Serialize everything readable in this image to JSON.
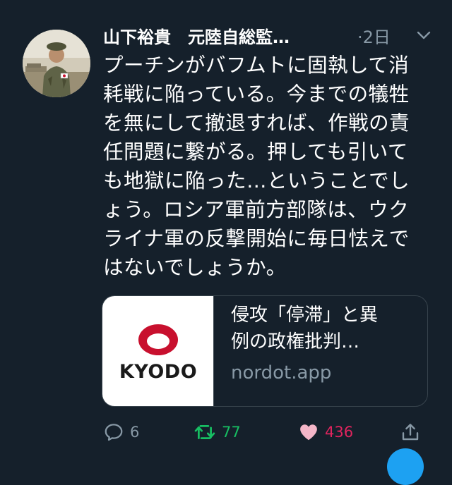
{
  "tweet": {
    "author_name": "山下裕貴　元陸自総監…",
    "timestamp": "·2日",
    "text_lines": [
      "プーチンがバフムトに固執して消",
      "耗戦に陥っている。今までの犠牲",
      "を無にして撤退すれば、作戦の責",
      "任問題に繋がる。押しても引いて",
      "も地獄に陥った…ということでし",
      "ょう。ロシア軍前方部隊は、ウク",
      "ライナ軍の反撃開始に毎日怯えで",
      "はないでしょうか。"
    ],
    "icons": {
      "more": "chevron-down-icon",
      "reply": "reply-icon",
      "retweet": "retweet-icon",
      "like": "heart-icon",
      "share": "share-icon"
    }
  },
  "card": {
    "logo_text": "KYODO",
    "title_lines": [
      "侵攻「停滞」と異",
      "例の政権批判…"
    ],
    "domain": "nordot.app"
  },
  "actions": {
    "reply_count": "6",
    "retweet_count": "77",
    "like_count": "436"
  },
  "colors": {
    "background": "#15202b",
    "secondary_text": "#8899a6",
    "retweet_active": "#17bf63",
    "like_active": "#e0245e",
    "card_border": "#38444d",
    "logo_red": "#c8102e"
  }
}
